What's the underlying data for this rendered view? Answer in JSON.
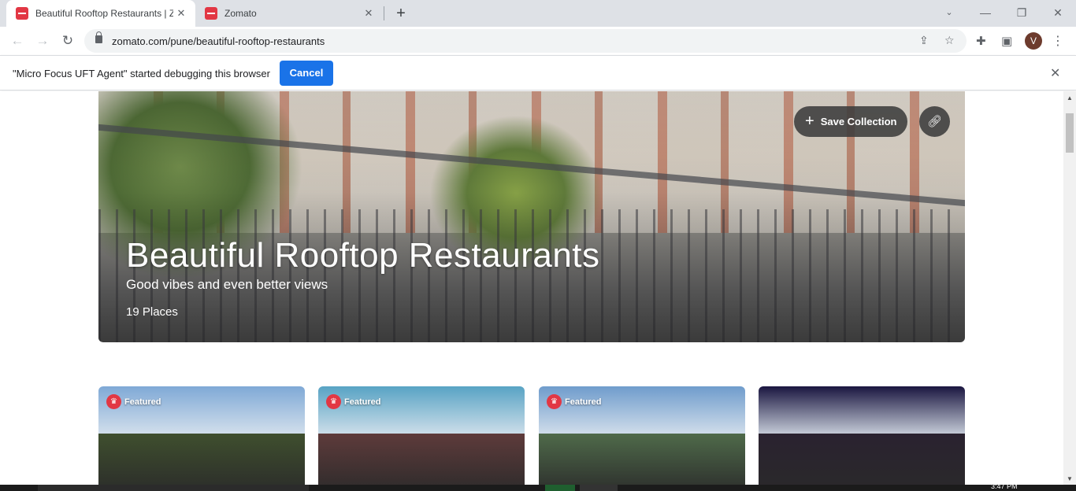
{
  "browser": {
    "tabs": [
      {
        "title": "Beautiful Rooftop Restaurants | Z",
        "active": true
      },
      {
        "title": "Zomato",
        "active": false
      }
    ],
    "url": "zomato.com/pune/beautiful-rooftop-restaurants",
    "profile_initial": "V"
  },
  "infobar": {
    "message": "\"Micro Focus UFT Agent\" started debugging this browser",
    "cancel_label": "Cancel"
  },
  "collection": {
    "title": "Beautiful Rooftop Restaurants",
    "subtitle": "Good vibes and even better views",
    "count": "19 Places",
    "save_label": "Save Collection"
  },
  "cards": [
    {
      "badge": "Featured",
      "featured": true,
      "sky": "#7fa9d6",
      "ground": "#3f4f2e"
    },
    {
      "badge": "Featured",
      "featured": true,
      "sky": "#58a3c4",
      "ground": "#5e3b3b"
    },
    {
      "badge": "Featured",
      "featured": true,
      "sky": "#6f9ccc",
      "ground": "#4f6a4a"
    },
    {
      "badge": "",
      "featured": false,
      "sky": "#1a1640",
      "ground": "#2a2230"
    }
  ],
  "taskbar": {
    "clock": "3:47 PM"
  },
  "colors": {
    "zomato_red": "#e23744",
    "button_blue": "#1a73e8"
  }
}
